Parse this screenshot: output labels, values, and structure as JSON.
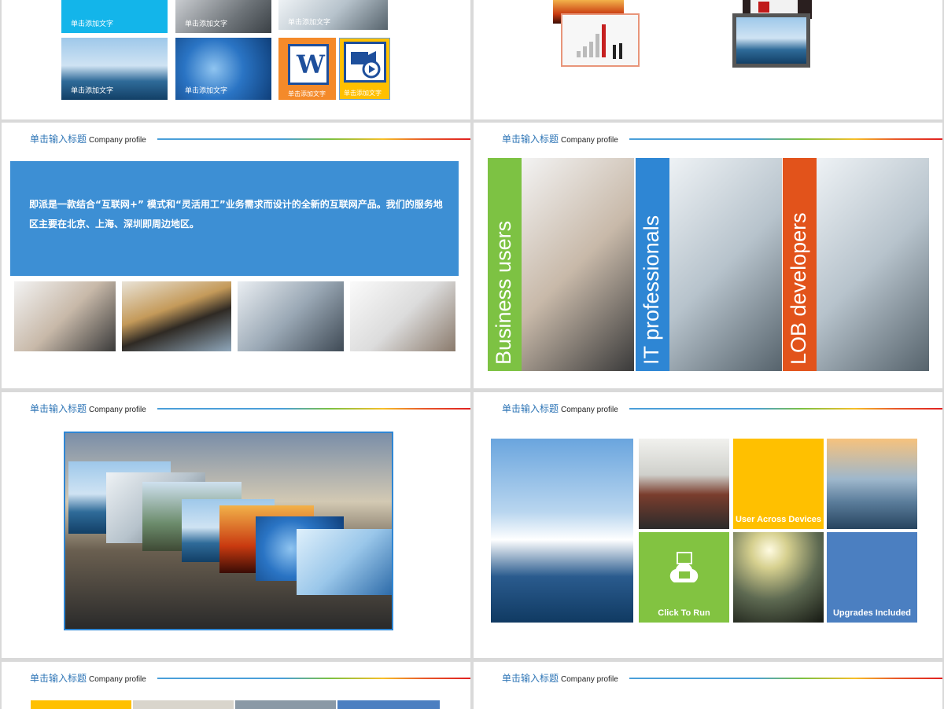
{
  "common": {
    "header_title": "单击输入标题",
    "header_sub": "Company profile"
  },
  "slide1": {
    "captions": [
      "单击添加文字",
      "单击添加文字",
      "单击添加文字",
      "单击添加文字",
      "单击添加文字",
      "单击添加文字",
      "单击添加文字"
    ],
    "word_letter": "W"
  },
  "slide3": {
    "paragraph": "即派是一款结合“互联网+” 模式和“灵活用工”业务需求而设计的全新的互联网产品。我们的服务地区主要在北京、上海、深圳即周边地区。"
  },
  "slide4": {
    "strips": [
      {
        "label": "Business users",
        "color": "#7dc243"
      },
      {
        "label": "IT professionals",
        "color": "#2e86d4"
      },
      {
        "label": "LOB developers",
        "color": "#e2531b"
      }
    ]
  },
  "slide6": {
    "tiles": [
      {
        "label": "User Across Devices",
        "color": "#ffc000"
      },
      {
        "label": "Click To Run",
        "color": "#82c341"
      },
      {
        "label": "Upgrades Included",
        "color": "#4b7fc1"
      }
    ]
  },
  "colors": {
    "accent_blue": "#2e75b6",
    "box_blue": "#3d8fd4",
    "yellow": "#ffc000",
    "orange": "#f48a2a"
  }
}
